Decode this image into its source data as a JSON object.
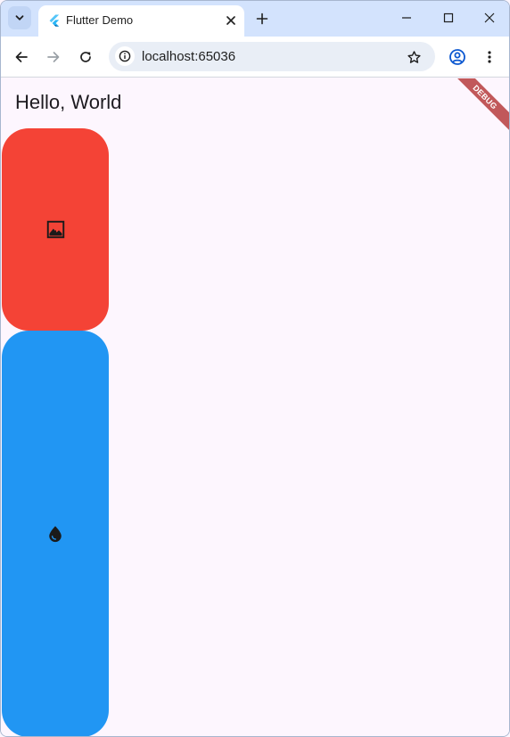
{
  "browser": {
    "tab": {
      "title": "Flutter Demo",
      "favicon": "flutter-logo-icon"
    },
    "address_bar": {
      "url": "localhost:65036"
    },
    "icons": {
      "tab_search": "chevron-down-icon",
      "tab_close": "close-icon",
      "new_tab": "plus-icon",
      "minimize": "minimize-icon",
      "maximize": "maximize-icon",
      "close_window": "close-icon",
      "back": "arrow-left-icon",
      "forward": "arrow-right-icon",
      "reload": "reload-icon",
      "site_info": "info-icon",
      "bookmark": "star-icon",
      "profile": "account-icon",
      "menu": "more-vert-icon"
    }
  },
  "app": {
    "heading": "Hello, World",
    "debug_banner": "DEBUG",
    "cards": [
      {
        "color": "#f44336",
        "icon": "image-icon"
      },
      {
        "color": "#2196f3",
        "icon": "water-drop-icon"
      }
    ]
  },
  "colors": {
    "tabstrip": "#d3e3fd",
    "page_background": "#fdf6fe",
    "red": "#f44336",
    "blue": "#2196f3"
  }
}
